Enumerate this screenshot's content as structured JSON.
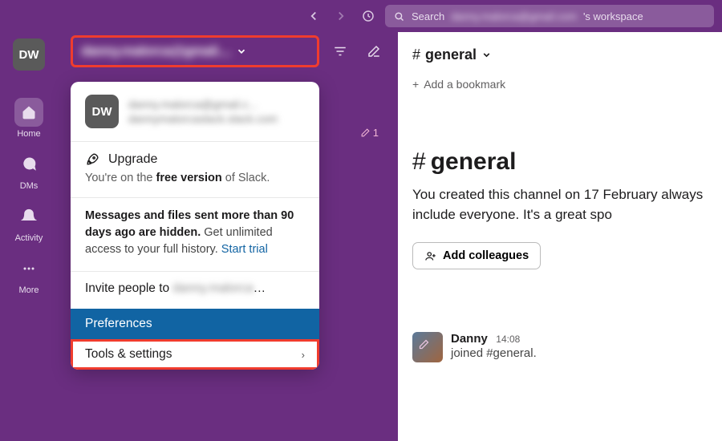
{
  "topbar": {
    "search_prefix": "Search",
    "workspace_blur": "danny.malorca@gmail.com",
    "search_suffix": "'s workspace"
  },
  "rail": {
    "avatar_initials": "DW",
    "items": [
      {
        "label": "Home"
      },
      {
        "label": "DMs"
      },
      {
        "label": "Activity"
      },
      {
        "label": "More"
      }
    ]
  },
  "workspace_header": {
    "name_blur": "danny.malorca@gmail....",
    "edit_count": "1"
  },
  "menu": {
    "avatar_initials": "DW",
    "head_line1": "danny.malorca@gmail.c...",
    "head_line2": "dannymalorcaslack.slack.com",
    "upgrade_label": "Upgrade",
    "upgrade_sub_pre": "You're on the ",
    "upgrade_sub_bold": "free version",
    "upgrade_sub_post": " of Slack.",
    "history_bold": "Messages and files sent more than 90 days ago are hidden.",
    "history_rest": " Get unlimited access to your full history. ",
    "history_link": "Start trial",
    "invite_pre": "Invite people to ",
    "invite_blur": "danny.malorca",
    "invite_post": "…",
    "preferences": "Preferences",
    "tools": "Tools & settings"
  },
  "channel": {
    "name": "general",
    "bookmark": "Add a bookmark",
    "desc": "You created this channel on 17 February always include everyone. It's a great spo",
    "add_colleagues": "Add colleagues"
  },
  "message": {
    "author": "Danny",
    "time": "14:08",
    "text": "joined #general."
  }
}
